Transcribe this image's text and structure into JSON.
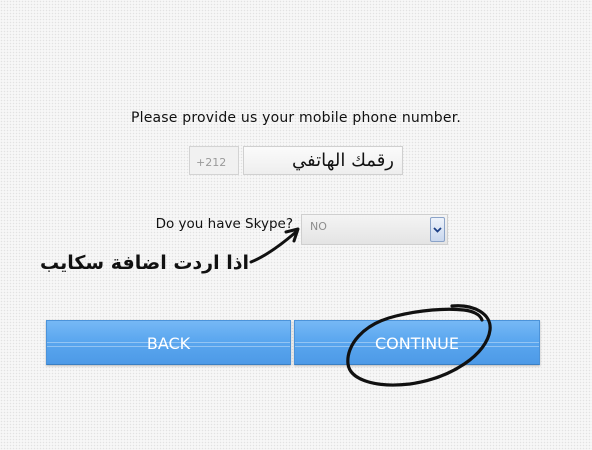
{
  "form": {
    "prompt": "Please provide us your mobile phone number.",
    "phone_prefix": "+212",
    "phone_placeholder": "رقمك الهاتفي",
    "skype_label": "Do you have Skype?",
    "skype_selected": "NO"
  },
  "annotation": {
    "text": "اذا اردت اضافة سكايب"
  },
  "buttons": {
    "back_label": "BACK",
    "continue_label": "CONTINUE"
  },
  "colors": {
    "button_blue": "#5ba7ef",
    "button_text": "#ffffff",
    "annotation_ink": "#111111"
  }
}
